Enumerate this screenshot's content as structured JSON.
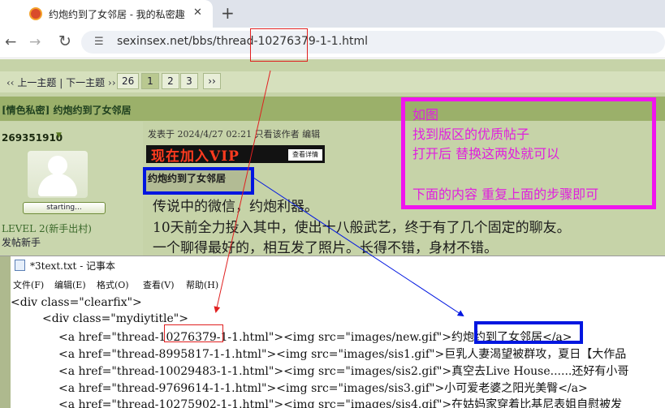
{
  "browser": {
    "tab_title": "约炮约到了女邻居 - 我的私密趣",
    "tab_close": "✕",
    "new_tab": "+",
    "url": "sexinsex.net/bbs/thread-10276379-1-1.html",
    "icons": {
      "back": "back-arrow-icon",
      "forward": "forward-arrow-icon",
      "reload": "reload-icon",
      "site_info": "site-info-icon",
      "favicon": "favicon-icon"
    }
  },
  "forum": {
    "nav_prev_next": "‹‹ 上一主题 | 下一主题 ››",
    "pages": [
      "26",
      "1",
      "2",
      "3",
      "››"
    ],
    "current_page": "1",
    "thread_title": "[情色私密] 约炮约到了女邻居",
    "author": {
      "username": "269351910",
      "level_badge": "starting...",
      "level": "LEVEL 2(新手出村)",
      "rank": "发帖新手"
    },
    "post": {
      "meta": "发表于 2024/4/27 02:21  只看该作者  编辑",
      "vip_banner": "现在加入VIP",
      "vip_sub": "查看详情",
      "title": "约炮约到了女邻居",
      "body_lines": [
        "传说中的微信，约炮利器。",
        "10天前全力投入其中，使出十八般武艺，终于有了几个固定的聊友。",
        "一个聊得最好的，相互发了照片。长得不错，身材不错。"
      ]
    }
  },
  "annotation": {
    "lines": [
      "如图",
      "找到版区的优质帖子",
      "打开后  替换这两处就可以",
      "",
      "下面的内容  重复上面的步骤即可"
    ],
    "colors": {
      "magenta": "#f015ee",
      "blue": "#0016e0",
      "red": "#e02020"
    }
  },
  "notepad": {
    "title": "*3text.txt - 记事本",
    "menus": [
      "文件(F)",
      "编辑(E)",
      "格式(O)",
      "查看(V)",
      "帮助(H)"
    ],
    "lines": [
      "<div class=\"clearfix\">",
      "<div class=\"mydiytitle\">",
      "<a href=\"thread-10276379-1-1.html\"><img src=\"images/new.gif\">约炮约到了女邻居</a>",
      "<a href=\"thread-8995817-1-1.html\"><img src=\"images/sis1.gif\">巨乳人妻渴望被群攻，夏日【大作品",
      "<a href=\"thread-10029483-1-1.html\"><img src=\"images/sis2.gif\">真空去Live House......还好有小哥",
      "<a href=\"thread-9769614-1-1.html\"><img src=\"images/sis3.gif\">小可爱老婆之阳光美臀</a>",
      "<a href=\"thread-10275902-1-1.html\"><img src=\"images/sis4.gif\">在姑妈家穿着比基尼表姐自慰被发"
    ]
  }
}
